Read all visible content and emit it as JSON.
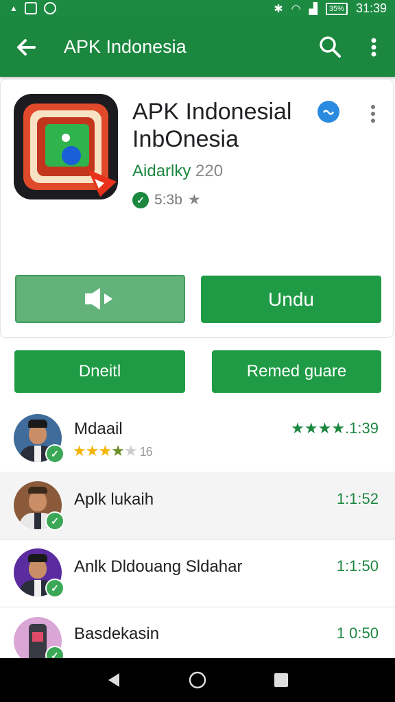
{
  "status_bar": {
    "time": "31:39",
    "battery_label": "35%",
    "icons": [
      "notification-icon",
      "image-icon",
      "circle-icon",
      "bluetooth-icon",
      "wifi-icon",
      "signal-icon",
      "battery-icon"
    ]
  },
  "app_bar": {
    "title": "APK Indonesia",
    "icons": [
      "back-arrow-icon",
      "search-icon",
      "more-vert-icon"
    ]
  },
  "app": {
    "name_line1": "APK Indonesial",
    "name_line2": "InbOnesia",
    "developer_name": "Aidarlky",
    "developer_num": "220",
    "rating_value": "5:3b"
  },
  "buttons": {
    "unduh": "Undu",
    "detail": "Dneitl",
    "remed": "Remed guare"
  },
  "list": [
    {
      "name": "Mdaail",
      "time": "★★★★.1:39",
      "stars_count": "16",
      "rating": 3.5
    },
    {
      "name": "Aplk lukaih",
      "time": "1:1:52"
    },
    {
      "name": "Anlk Dldouang Sldahar",
      "time": "1:1:50"
    },
    {
      "name": "Basdekasin",
      "time": "1 0:50"
    }
  ],
  "colors": {
    "primary": "#1b873f",
    "button": "#1f9a45",
    "button_light": "#62b27a",
    "star_yellow": "#f4b400",
    "verified_blue": "#2a8ae0"
  }
}
